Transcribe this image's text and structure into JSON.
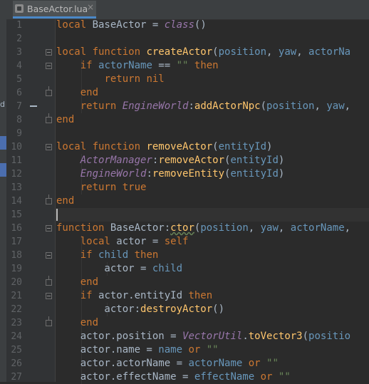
{
  "tab": {
    "filename": "BaseActor.lua",
    "close": "×"
  },
  "left_strip_text": "d",
  "lines": [
    {
      "n": "1",
      "t": [
        {
          "k": "k",
          "v": "local "
        },
        {
          "k": "",
          "v": "BaseActor = "
        },
        {
          "k": "g",
          "v": "class"
        },
        {
          "k": "",
          "v": "()"
        }
      ]
    },
    {
      "n": "2",
      "t": []
    },
    {
      "n": "3",
      "t": [
        {
          "k": "k",
          "v": "local function "
        },
        {
          "k": "f",
          "v": "createActor"
        },
        {
          "k": "",
          "v": "("
        },
        {
          "k": "p",
          "v": "position"
        },
        {
          "k": "",
          "v": ", "
        },
        {
          "k": "p",
          "v": "yaw"
        },
        {
          "k": "",
          "v": ", "
        },
        {
          "k": "p",
          "v": "actorNa"
        }
      ]
    },
    {
      "n": "4",
      "t": [
        {
          "k": "",
          "v": "    "
        },
        {
          "k": "k",
          "v": "if "
        },
        {
          "k": "p",
          "v": "actorName"
        },
        {
          "k": "",
          "v": " == "
        },
        {
          "k": "s",
          "v": "\"\""
        },
        {
          "k": "",
          "v": " "
        },
        {
          "k": "k",
          "v": "then"
        }
      ]
    },
    {
      "n": "5",
      "t": [
        {
          "k": "",
          "v": "        "
        },
        {
          "k": "k",
          "v": "return nil"
        }
      ]
    },
    {
      "n": "6",
      "t": [
        {
          "k": "",
          "v": "    "
        },
        {
          "k": "k",
          "v": "end"
        }
      ]
    },
    {
      "n": "7",
      "t": [
        {
          "k": "",
          "v": "    "
        },
        {
          "k": "k",
          "v": "return "
        },
        {
          "k": "g",
          "v": "EngineWorld"
        },
        {
          "k": "",
          "v": ":"
        },
        {
          "k": "f",
          "v": "addActorNpc"
        },
        {
          "k": "",
          "v": "("
        },
        {
          "k": "p",
          "v": "position"
        },
        {
          "k": "",
          "v": ", "
        },
        {
          "k": "p",
          "v": "yaw"
        },
        {
          "k": "",
          "v": ","
        }
      ]
    },
    {
      "n": "8",
      "t": [
        {
          "k": "k",
          "v": "end"
        }
      ]
    },
    {
      "n": "9",
      "t": []
    },
    {
      "n": "10",
      "t": [
        {
          "k": "k",
          "v": "local function "
        },
        {
          "k": "f",
          "v": "removeActor"
        },
        {
          "k": "",
          "v": "("
        },
        {
          "k": "p",
          "v": "entityId"
        },
        {
          "k": "",
          "v": ")"
        }
      ]
    },
    {
      "n": "11",
      "t": [
        {
          "k": "",
          "v": "    "
        },
        {
          "k": "g",
          "v": "ActorManager"
        },
        {
          "k": "",
          "v": ":"
        },
        {
          "k": "f",
          "v": "removeActor"
        },
        {
          "k": "",
          "v": "("
        },
        {
          "k": "p",
          "v": "entityId"
        },
        {
          "k": "",
          "v": ")"
        }
      ]
    },
    {
      "n": "12",
      "t": [
        {
          "k": "",
          "v": "    "
        },
        {
          "k": "g",
          "v": "EngineWorld"
        },
        {
          "k": "",
          "v": ":"
        },
        {
          "k": "f",
          "v": "removeEntity"
        },
        {
          "k": "",
          "v": "("
        },
        {
          "k": "p",
          "v": "entityId"
        },
        {
          "k": "",
          "v": ")"
        }
      ]
    },
    {
      "n": "13",
      "t": [
        {
          "k": "",
          "v": "    "
        },
        {
          "k": "k",
          "v": "return true"
        }
      ]
    },
    {
      "n": "14",
      "t": [
        {
          "k": "k",
          "v": "end"
        }
      ]
    },
    {
      "n": "15",
      "t": []
    },
    {
      "n": "16",
      "t": [
        {
          "k": "k",
          "v": "function "
        },
        {
          "k": "",
          "v": "BaseActor:"
        },
        {
          "k": "f sq",
          "v": "ctor"
        },
        {
          "k": "",
          "v": "("
        },
        {
          "k": "p",
          "v": "position"
        },
        {
          "k": "",
          "v": ", "
        },
        {
          "k": "p",
          "v": "yaw"
        },
        {
          "k": "",
          "v": ", "
        },
        {
          "k": "p",
          "v": "actorName"
        },
        {
          "k": "",
          "v": ","
        }
      ]
    },
    {
      "n": "17",
      "t": [
        {
          "k": "",
          "v": "    "
        },
        {
          "k": "k",
          "v": "local "
        },
        {
          "k": "",
          "v": "actor = "
        },
        {
          "k": "k",
          "v": "self"
        }
      ]
    },
    {
      "n": "18",
      "t": [
        {
          "k": "",
          "v": "    "
        },
        {
          "k": "k",
          "v": "if "
        },
        {
          "k": "p",
          "v": "child"
        },
        {
          "k": "",
          "v": " "
        },
        {
          "k": "k",
          "v": "then"
        }
      ]
    },
    {
      "n": "19",
      "t": [
        {
          "k": "",
          "v": "        actor = "
        },
        {
          "k": "p",
          "v": "child"
        }
      ]
    },
    {
      "n": "20",
      "t": [
        {
          "k": "",
          "v": "    "
        },
        {
          "k": "k",
          "v": "end"
        }
      ]
    },
    {
      "n": "21",
      "t": [
        {
          "k": "",
          "v": "    "
        },
        {
          "k": "k",
          "v": "if "
        },
        {
          "k": "",
          "v": "actor.entityId "
        },
        {
          "k": "k",
          "v": "then"
        }
      ]
    },
    {
      "n": "22",
      "t": [
        {
          "k": "",
          "v": "        actor:"
        },
        {
          "k": "f",
          "v": "destroyActor"
        },
        {
          "k": "",
          "v": "()"
        }
      ]
    },
    {
      "n": "23",
      "t": [
        {
          "k": "",
          "v": "    "
        },
        {
          "k": "k",
          "v": "end"
        }
      ]
    },
    {
      "n": "24",
      "t": [
        {
          "k": "",
          "v": "    actor.position = "
        },
        {
          "k": "g",
          "v": "VectorUtil"
        },
        {
          "k": "",
          "v": "."
        },
        {
          "k": "f",
          "v": "toVector3"
        },
        {
          "k": "",
          "v": "("
        },
        {
          "k": "p",
          "v": "positio"
        }
      ]
    },
    {
      "n": "25",
      "t": [
        {
          "k": "",
          "v": "    actor.name = "
        },
        {
          "k": "p",
          "v": "name"
        },
        {
          "k": "",
          "v": " "
        },
        {
          "k": "k",
          "v": "or "
        },
        {
          "k": "s",
          "v": "\"\""
        }
      ]
    },
    {
      "n": "26",
      "t": [
        {
          "k": "",
          "v": "    actor.actorName = "
        },
        {
          "k": "p",
          "v": "actorName"
        },
        {
          "k": "",
          "v": " "
        },
        {
          "k": "k",
          "v": "or "
        },
        {
          "k": "s",
          "v": "\"\""
        }
      ]
    },
    {
      "n": "27",
      "t": [
        {
          "k": "",
          "v": "    actor.effectName = "
        },
        {
          "k": "p",
          "v": "effectName"
        },
        {
          "k": "",
          "v": " "
        },
        {
          "k": "k",
          "v": "or "
        },
        {
          "k": "s",
          "v": "\"\""
        }
      ]
    }
  ]
}
